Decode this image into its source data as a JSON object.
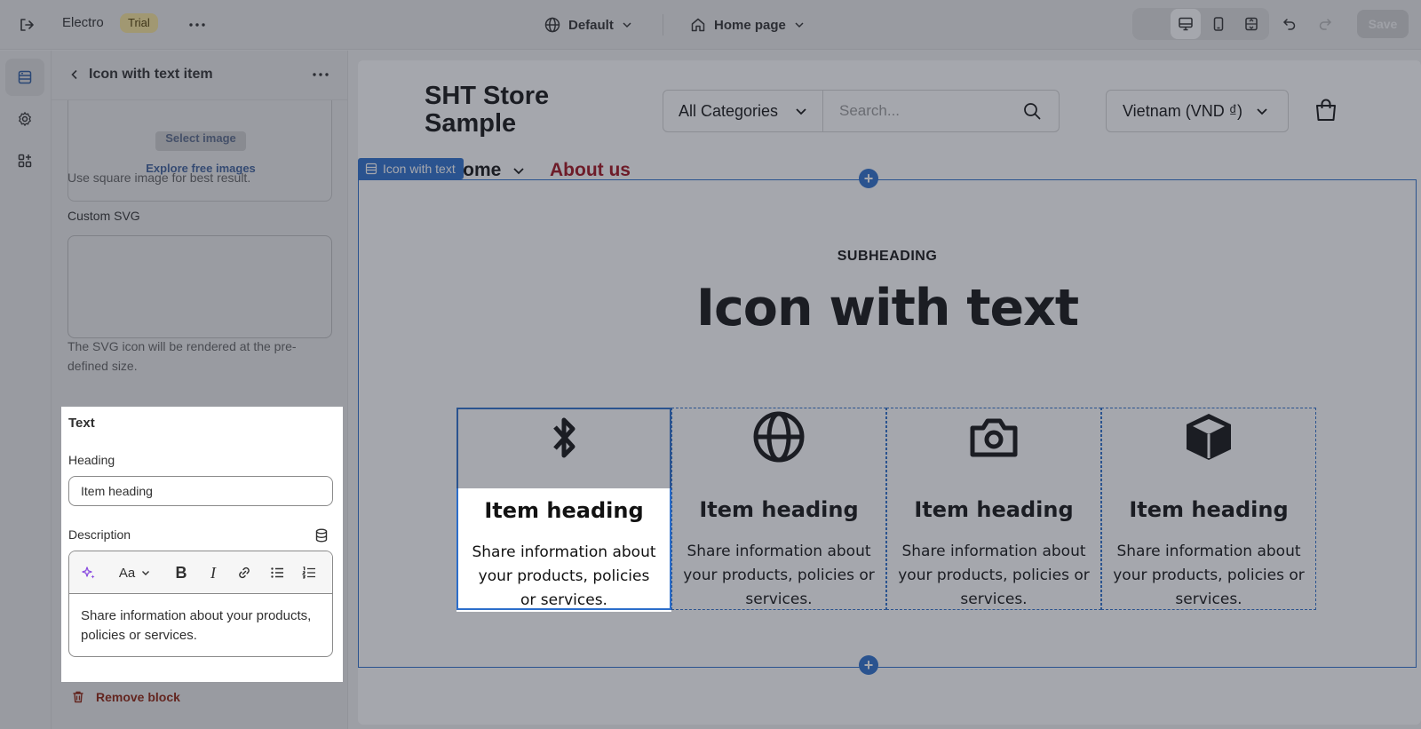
{
  "topbar": {
    "app_name": "Electro",
    "badge": "Trial",
    "theme": "Default",
    "page": "Home page",
    "save": "Save"
  },
  "panel": {
    "title": "Icon with text item",
    "select_image": "Select image",
    "explore": "Explore free images",
    "image_hint": "Use square image for best result.",
    "custom_svg_label": "Custom SVG",
    "svg_hint": "The SVG icon will be rendered at the pre-defined size.",
    "text_section": "Text",
    "heading_label": "Heading",
    "heading_value": "Item heading",
    "description_label": "Description",
    "rte_font_label": "Aa",
    "description_value": "Share information about your products, policies or services.",
    "remove": "Remove block"
  },
  "preview": {
    "store_name": "SHT Store Sample",
    "category": "All Categories",
    "search_placeholder": "Search...",
    "country": "Vietnam (VND ₫)",
    "nav_home": "Home",
    "nav_about": "About us",
    "section_tag": "Icon with text",
    "subheading": "SUBHEADING",
    "heading": "Icon with text",
    "items": [
      {
        "icon": "bluetooth-icon",
        "heading": "Item heading",
        "text": "Share information about your products, policies or services."
      },
      {
        "icon": "globe-icon",
        "heading": "Item heading",
        "text": "Share information about your products, policies or services."
      },
      {
        "icon": "camera-icon",
        "heading": "Item heading",
        "text": "Share information about your products, policies or services."
      },
      {
        "icon": "box-icon",
        "heading": "Item heading",
        "text": "Share information about your products, policies or services."
      }
    ]
  },
  "colors": {
    "accent": "#2c6ecb",
    "about_link": "#a0111c",
    "trial_badge": "#f8e59a",
    "remove": "#8e1f0b"
  }
}
